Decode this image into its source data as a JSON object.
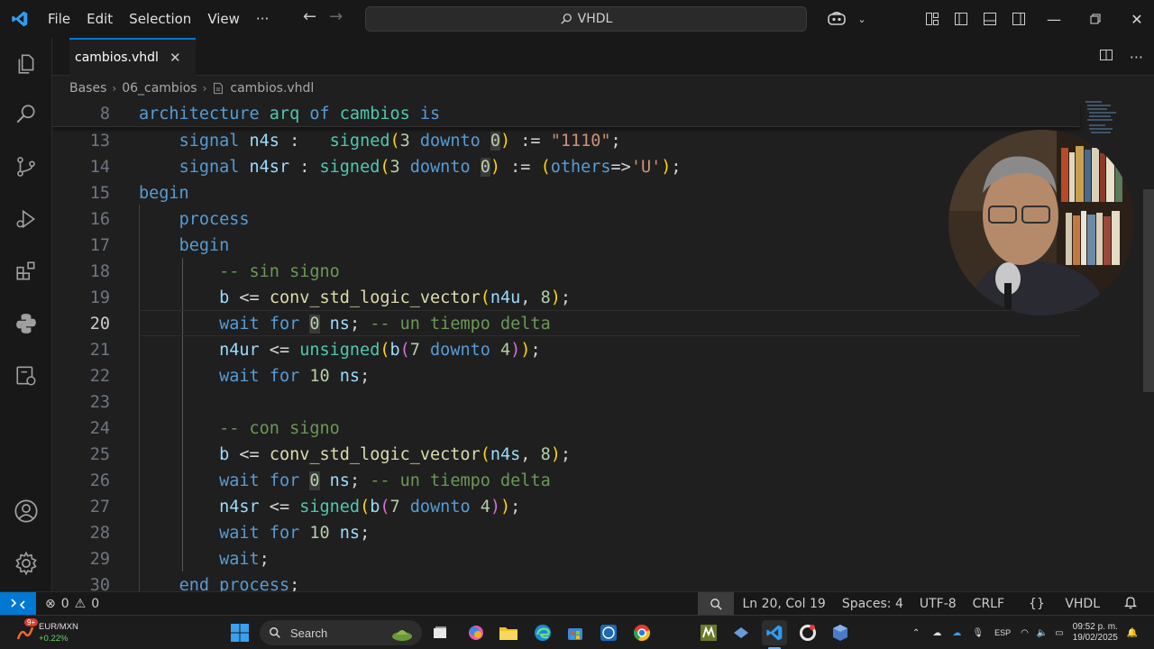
{
  "menu": [
    "File",
    "Edit",
    "Selection",
    "View",
    "···"
  ],
  "command_center": {
    "label": "VHDL"
  },
  "tab": {
    "label": "cambios.vhdl"
  },
  "breadcrumb": [
    "Bases",
    "06_cambios",
    "cambios.vhdl"
  ],
  "colors": {
    "accent": "#0078d4",
    "background": "#1f1f1f",
    "keyword": "#569cd6",
    "comment": "#6a9955",
    "string": "#ce9178",
    "number": "#b5cea8"
  },
  "editor": {
    "sticky_line_number": "8",
    "line_numbers": [
      "13",
      "14",
      "15",
      "16",
      "17",
      "18",
      "19",
      "20",
      "21",
      "22",
      "23",
      "24",
      "25",
      "26",
      "27",
      "28",
      "29",
      "30"
    ],
    "active_line": "20"
  },
  "status": {
    "problems_errors": "0",
    "problems_warnings": "0",
    "position": "Ln 20, Col 19",
    "spaces": "Spaces: 4",
    "encoding": "UTF-8",
    "eol": "CRLF",
    "language": "VHDL"
  },
  "taskbar": {
    "weather_badge": "9+",
    "ticker_name": "EUR/MXN",
    "ticker_change": "+0.22%",
    "search_label": "Search",
    "language": "ESP",
    "time": "09:52 p. m.",
    "date": "19/02/2025"
  }
}
